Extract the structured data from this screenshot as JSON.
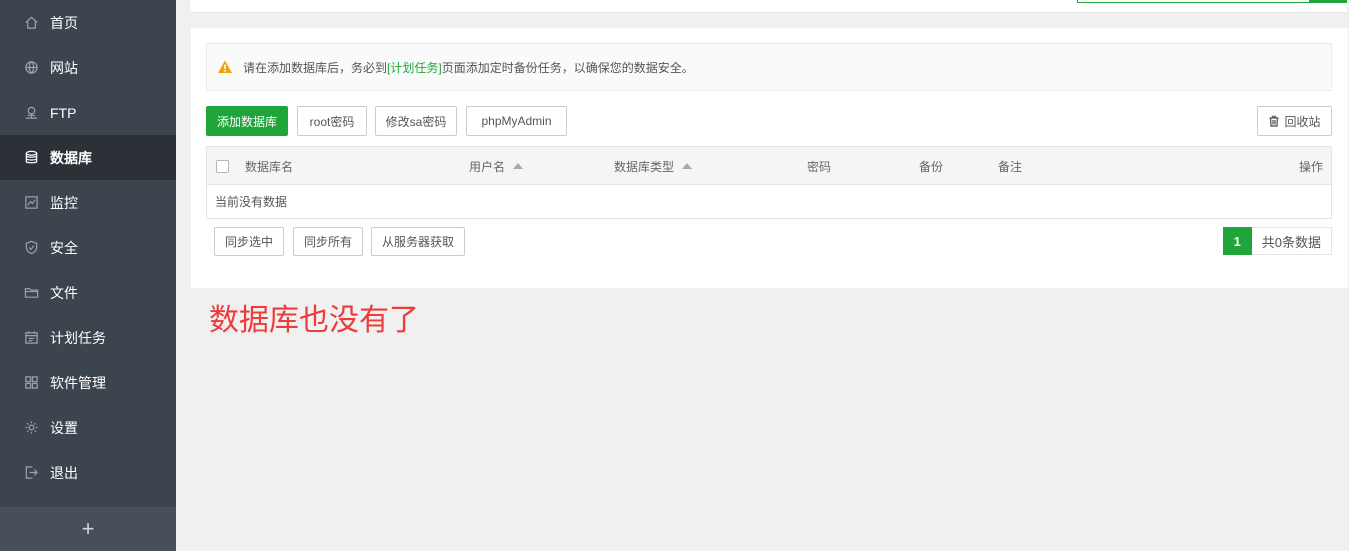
{
  "sidebar": {
    "items": [
      {
        "label": "首页",
        "icon": "home-icon"
      },
      {
        "label": "网站",
        "icon": "globe-icon"
      },
      {
        "label": "FTP",
        "icon": "ftp-icon"
      },
      {
        "label": "数据库",
        "icon": "database-icon",
        "active": true
      },
      {
        "label": "监控",
        "icon": "monitor-icon"
      },
      {
        "label": "安全",
        "icon": "shield-icon"
      },
      {
        "label": "文件",
        "icon": "folder-icon"
      },
      {
        "label": "计划任务",
        "icon": "calendar-icon"
      },
      {
        "label": "软件管理",
        "icon": "grid-icon"
      },
      {
        "label": "设置",
        "icon": "gear-icon"
      },
      {
        "label": "退出",
        "icon": "logout-icon"
      }
    ],
    "add_label": "+"
  },
  "alert": {
    "prefix": "请在添加数据库后，务必到",
    "link": "[计划任务]",
    "suffix": "页面添加定时备份任务，以确保您的数据安全。"
  },
  "toolbar": {
    "add_db": "添加数据库",
    "root_pwd": "root密码",
    "sa_pwd": "修改sa密码",
    "phpmyadmin": "phpMyAdmin",
    "recycle": "回收站"
  },
  "table": {
    "columns": [
      "数据库名",
      "用户名",
      "数据库类型",
      "密码",
      "备份",
      "备注",
      "操作"
    ],
    "empty_text": "当前没有数据"
  },
  "footer": {
    "sync_selected": "同步选中",
    "sync_all": "同步所有",
    "fetch_server": "从服务器获取"
  },
  "pagination": {
    "current": "1",
    "total_text": "共0条数据"
  },
  "annotation": "数据库也没有了",
  "colors": {
    "accent": "#20a53a",
    "sidebar_bg": "#3c444d",
    "annotation": "#ee3b3b"
  }
}
